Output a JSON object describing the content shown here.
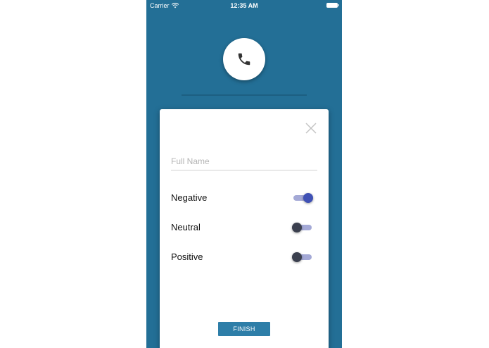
{
  "status_bar": {
    "carrier": "Carrier",
    "time": "12:35 AM",
    "wifi_icon": "wifi-icon",
    "battery_icon": "battery-icon"
  },
  "header": {
    "avatar_icon": "phone-icon"
  },
  "form": {
    "close_icon": "close-icon",
    "full_name": {
      "value": "",
      "placeholder": "Full Name"
    },
    "toggles": [
      {
        "label": "Negative",
        "on": true
      },
      {
        "label": "Neutral",
        "on": false
      },
      {
        "label": "Positive",
        "on": false
      }
    ],
    "finish_label": "FINISH"
  },
  "colors": {
    "background": "#236f96",
    "card": "#ffffff",
    "toggle_on_knob": "#3f51b5",
    "toggle_off_knob": "#3a3f4e",
    "toggle_track": "#a4a9d6",
    "button": "#2e7ea8"
  }
}
